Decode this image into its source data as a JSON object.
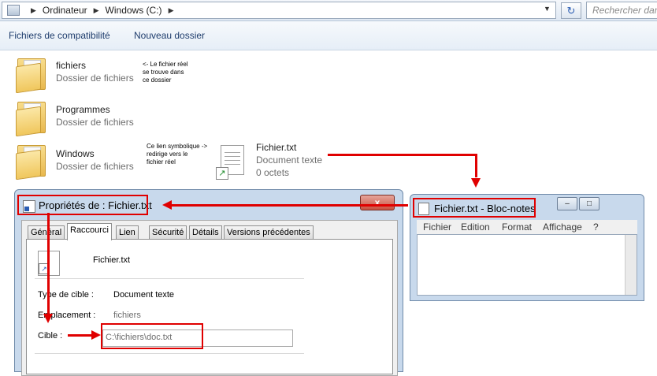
{
  "address_bar": {
    "crumbs": [
      "Ordinateur",
      "Windows (C:)"
    ],
    "search_placeholder": "Rechercher dans"
  },
  "toolbar": {
    "compat_files": "Fichiers de compatibilité",
    "new_folder": "Nouveau dossier"
  },
  "items": [
    {
      "name": "fichiers",
      "type": "Dossier de fichiers",
      "icon": "folder-icon"
    },
    {
      "name": "Programmes",
      "type": "Dossier de fichiers",
      "icon": "folder-icon"
    },
    {
      "name": "Windows",
      "type": "Dossier de fichiers",
      "icon": "folder-icon"
    }
  ],
  "file_item": {
    "name": "Fichier.txt",
    "type": "Document texte",
    "size": "0 octets",
    "icon": "text-shortcut-icon"
  },
  "notes": {
    "real_file": [
      "<- Le fichier réel",
      "se trouve dans",
      "ce dossier"
    ],
    "symlink": [
      "Ce lien symbolique ->",
      "redirige vers le",
      "fichier réel"
    ]
  },
  "properties": {
    "title": "Propriétés de : Fichier.txt",
    "close": "x",
    "tabs": [
      "Général",
      "Raccourci",
      "Lien",
      "Sécurité",
      "Détails",
      "Versions précédentes"
    ],
    "active_tab": "Raccourci",
    "file_name": "Fichier.txt",
    "target_type_label": "Type de cible :",
    "target_type_value": "Document texte",
    "location_label": "Emplacement :",
    "location_value": "fichiers",
    "target_label": "Cible :",
    "target_value": "C:\\fichiers\\doc.txt"
  },
  "notepad": {
    "title": "Fichier.txt - Bloc-notes",
    "menu": [
      "Fichier",
      "Edition",
      "Format",
      "Affichage",
      "?"
    ],
    "buttons": {
      "minimize": "–",
      "maximize": "□"
    }
  },
  "colors": {
    "annotation_red": "#e00000",
    "window_frame": "#c8d9ec",
    "toolbar_text": "#1e3c6c"
  }
}
